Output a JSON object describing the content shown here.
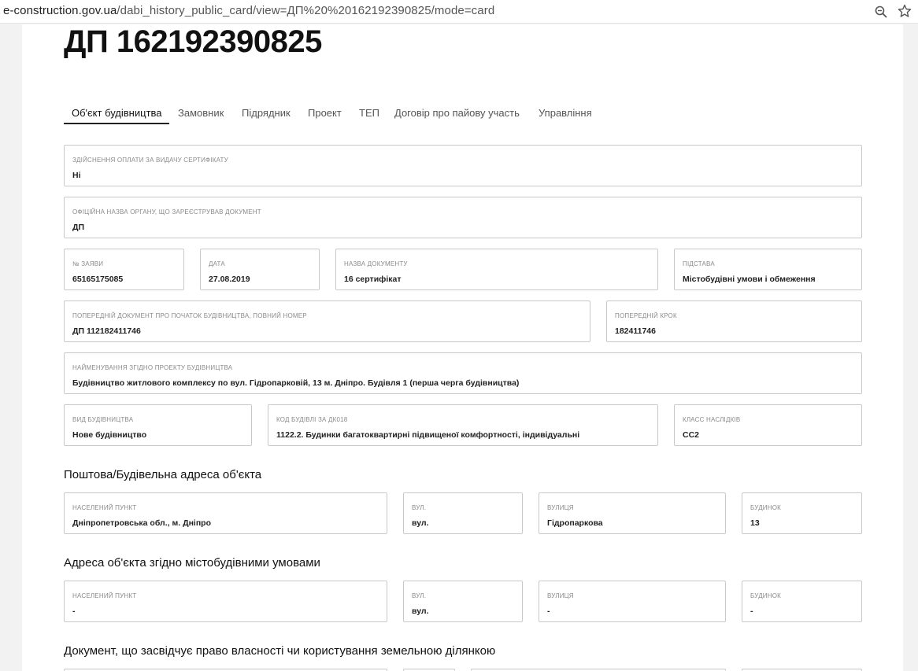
{
  "browser": {
    "url_host": "e-construction.gov.ua",
    "url_path": "/dabi_history_public_card/view=ДП%20%20162192390825/mode=card"
  },
  "page": {
    "title": "ДП 162192390825"
  },
  "tabs": [
    {
      "label": "Об'єкт будівництва",
      "active": true
    },
    {
      "label": "Замовник"
    },
    {
      "label": "Підрядник"
    },
    {
      "label": "Проект"
    },
    {
      "label": "ТЕП"
    },
    {
      "label": "Договір про пайову участь"
    },
    {
      "label": "Управління"
    }
  ],
  "fields": {
    "payment": {
      "label": "Здійснення оплати за видачу сертифікату",
      "value": "Ні"
    },
    "authority": {
      "label": "Офіційна назва органу, що зареєстрував документ",
      "value": "ДП"
    },
    "application_no": {
      "label": "№ заяви",
      "value": "65165175085"
    },
    "date": {
      "label": "Дата",
      "value": "27.08.2019"
    },
    "doc_name": {
      "label": "Назва документу",
      "value": "16 сертифікат"
    },
    "basis": {
      "label": "Підстава",
      "value": "Містобудівні умови і обмеження"
    },
    "prev_doc": {
      "label": "Попередній документ про початок будівництва, повний номер",
      "value": "ДП 112182411746"
    },
    "prev_step": {
      "label": "Попередній крок",
      "value": "182411746"
    },
    "project_name": {
      "label": "Найменування згідно проекту будівництва",
      "value": "Будівництво житлового комплексу по вул. Гідропарковій, 13 м. Дніпро. Будівля 1 (перша черга будівництва)"
    },
    "construction_type": {
      "label": "Вид будівництва",
      "value": "Нове будівництво"
    },
    "building_code": {
      "label": "Код будівлі за ДК018",
      "value": "1122.2. Будинки багатоквартирні підвищеної комфортності, індивідуальні"
    },
    "consequence_class": {
      "label": "Класс наслідків",
      "value": "СС2"
    }
  },
  "section_postal": {
    "title": "Поштова/Будівельна адреса об'єкта",
    "locality": {
      "label": "Населений пункт",
      "value": "Дніпропетровська обл., м. Дніпро"
    },
    "street_type": {
      "label": "Вул.",
      "value": "вул."
    },
    "street": {
      "label": "Вулиця",
      "value": "Гідропаркова"
    },
    "building": {
      "label": "Будинок",
      "value": "13"
    }
  },
  "section_conditions": {
    "title": "Адреса об'єкта згідно містобудівними умовами",
    "locality": {
      "label": "Населений пункт",
      "value": "-"
    },
    "street_type": {
      "label": "Вул.",
      "value": "вул."
    },
    "street": {
      "label": "Вулиця",
      "value": "-"
    },
    "building": {
      "label": "Будинок",
      "value": "-"
    }
  },
  "section_land": {
    "title": "Документ, що засвідчує право власності чи користування земельною ділянкою"
  }
}
